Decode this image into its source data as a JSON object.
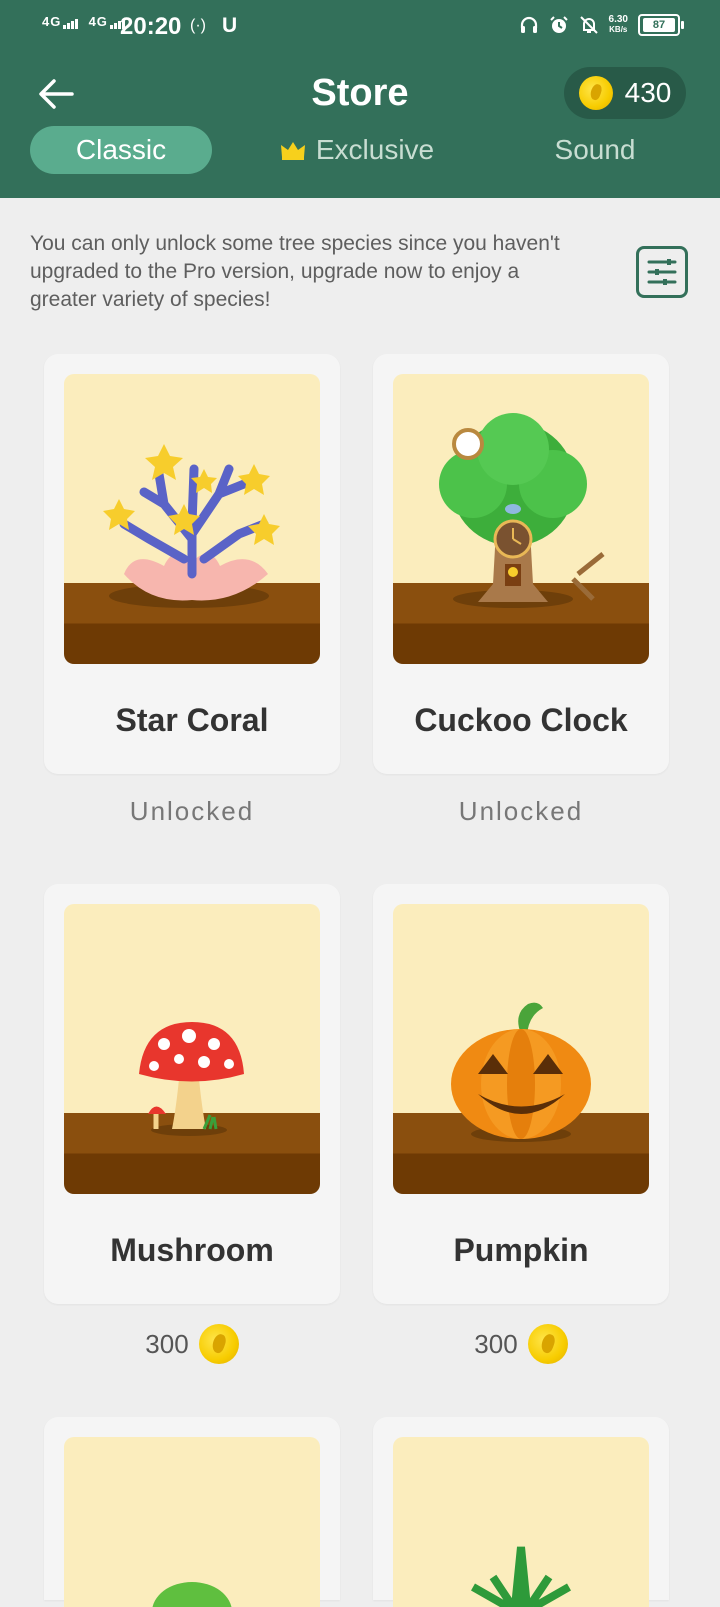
{
  "status_bar": {
    "network_1": "4G",
    "network_2": "4G",
    "time": "20:20",
    "hotspot": "(·)",
    "carrier_icon": "U",
    "speed_value": "6.30",
    "speed_unit": "KB/s",
    "battery": "87"
  },
  "header": {
    "title": "Store",
    "coins": "430"
  },
  "tabs": [
    {
      "label": "Classic",
      "active": true
    },
    {
      "label": "Exclusive",
      "active": false,
      "icon": "crown-icon"
    },
    {
      "label": "Sound",
      "active": false
    }
  ],
  "notice": "You can only unlock some tree species since you haven't upgraded to the Pro version, upgrade now to enjoy a greater variety of species!",
  "items": [
    {
      "name": "Star Coral",
      "status": "Unlocked"
    },
    {
      "name": "Cuckoo Clock",
      "status": "Unlocked"
    },
    {
      "name": "Mushroom",
      "price": "300"
    },
    {
      "name": "Pumpkin",
      "price": "300"
    }
  ],
  "colors": {
    "header_bg": "#33705a",
    "tab_active_bg": "#5aac8e",
    "page_bg": "#eeeeee",
    "card_bg": "#f5f5f5"
  }
}
